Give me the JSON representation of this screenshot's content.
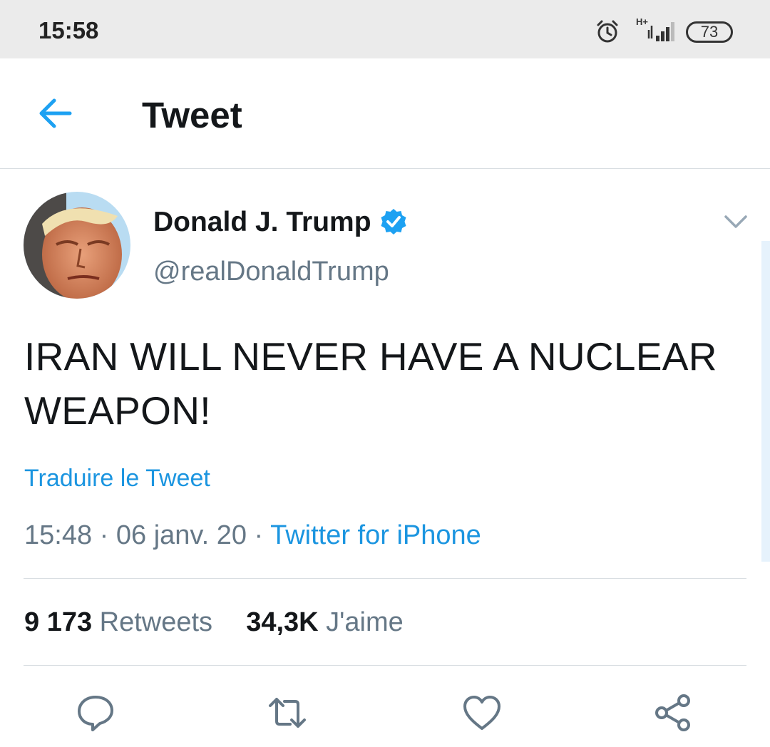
{
  "status_bar": {
    "time": "15:58",
    "network": "H+",
    "battery": "73"
  },
  "header": {
    "title": "Tweet"
  },
  "tweet": {
    "author_name": "Donald J. Trump",
    "author_handle": "@realDonaldTrump",
    "text": "IRAN WILL NEVER HAVE A NUCLEAR WEAPON!",
    "translate_label": "Traduire le Tweet",
    "time": "15:48",
    "date": "06 janv. 20",
    "source": "Twitter for iPhone",
    "retweets_count": "9 173",
    "retweets_label": "Retweets",
    "likes_count": "34,3K",
    "likes_label": "J'aime"
  },
  "icons": {
    "back": "arrow-left-icon",
    "verified": "verified-badge-icon",
    "menu": "chevron-down-icon",
    "reply": "reply-icon",
    "retweet": "retweet-icon",
    "like": "heart-icon",
    "share": "share-icon"
  },
  "colors": {
    "accent": "#1da1f2",
    "link": "#1b95e0",
    "secondary_text": "#657786",
    "primary_text": "#14171a"
  }
}
